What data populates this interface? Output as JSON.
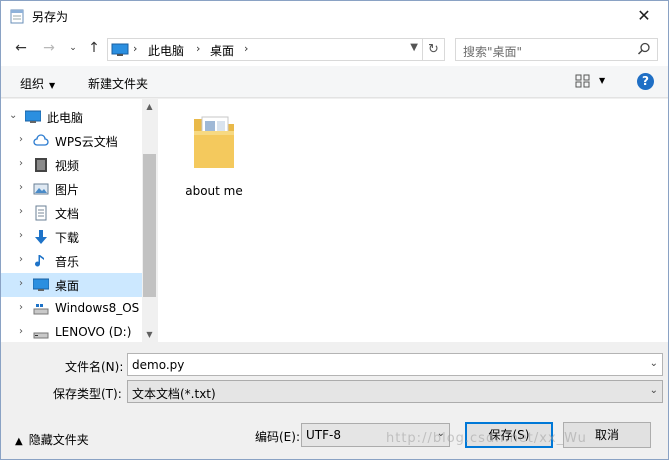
{
  "window": {
    "title": "另存为"
  },
  "address": {
    "crumbs": [
      "此电脑",
      "桌面"
    ]
  },
  "search": {
    "placeholder": "搜索\"桌面\""
  },
  "toolbar": {
    "organize": "组织",
    "new_folder": "新建文件夹"
  },
  "nav": {
    "items": [
      {
        "label": "此电脑",
        "icon": "computer-icon"
      },
      {
        "label": "WPS云文档",
        "icon": "cloud-icon"
      },
      {
        "label": "视频",
        "icon": "video-icon"
      },
      {
        "label": "图片",
        "icon": "pictures-icon"
      },
      {
        "label": "文档",
        "icon": "documents-icon"
      },
      {
        "label": "下载",
        "icon": "download-icon"
      },
      {
        "label": "音乐",
        "icon": "music-icon"
      },
      {
        "label": "桌面",
        "icon": "desktop-icon",
        "selected": true
      },
      {
        "label": "Windows8_OS",
        "icon": "drive-icon"
      },
      {
        "label": "LENOVO (D:)",
        "icon": "drive-icon"
      }
    ]
  },
  "files": [
    {
      "name": "about me",
      "type": "folder"
    }
  ],
  "form": {
    "filename_label": "文件名(N):",
    "filename_value": "demo.py",
    "filetype_label": "保存类型(T):",
    "filetype_value": "文本文档(*.txt)",
    "encoding_label": "编码(E):",
    "encoding_value": "UTF-8"
  },
  "footer": {
    "hide_folders": "隐藏文件夹",
    "save": "保存(S)",
    "cancel": "取消",
    "watermark": "http://blog.csdn.net/xx_Wu"
  },
  "colors": {
    "accent": "#0078d7",
    "selection": "#cce8ff",
    "folder": "#f4c95d"
  }
}
